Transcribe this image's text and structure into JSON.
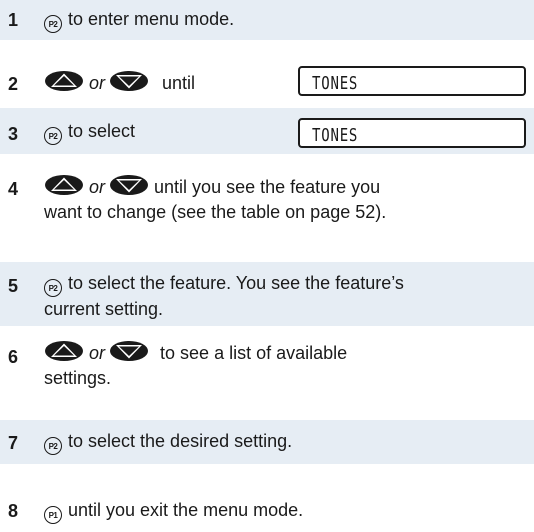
{
  "steps": [
    {
      "num": "1",
      "button": "P2",
      "text": "to enter menu mode."
    },
    {
      "num": "2",
      "or": "or",
      "text": "until",
      "display": "TONES"
    },
    {
      "num": "3",
      "button": "P2",
      "text": "to select",
      "display": "TONES"
    },
    {
      "num": "4",
      "or": "or",
      "text": "until you see the feature you",
      "text2": "want to change (see the table on page 52)."
    },
    {
      "num": "5",
      "button": "P2",
      "text": "to select the feature. You see the feature’s",
      "text2": "current setting."
    },
    {
      "num": "6",
      "or": "or",
      "text": "to see a list of available",
      "text2": "settings."
    },
    {
      "num": "7",
      "button": "P2",
      "text": "to select the desired setting."
    },
    {
      "num": "8",
      "button": "P1",
      "text": "until you exit the menu mode."
    }
  ],
  "icons": {
    "up": "up-arrow-icon",
    "down": "down-arrow-icon"
  }
}
